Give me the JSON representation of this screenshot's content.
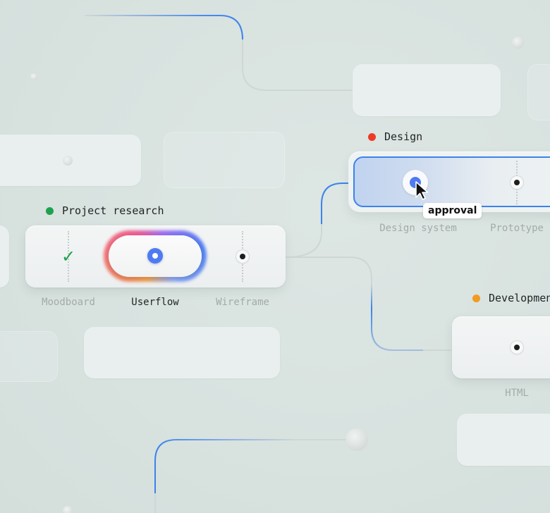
{
  "colors": {
    "background": "#d8e3e0",
    "connector_blue": "#3c83ec",
    "status_green": "#1ca24e",
    "status_red": "#ee3a26",
    "status_orange": "#f29a22",
    "check_green": "#1aa24c",
    "node_blue": "#4f7bf1"
  },
  "groups": {
    "project_research": {
      "title": "Project research",
      "status_color": "#1ca24e",
      "steps": [
        {
          "label": "Moodboard",
          "state": "done",
          "icon": "checkmark-icon"
        },
        {
          "label": "Userflow",
          "state": "active",
          "icon": "active-node-icon"
        },
        {
          "label": "Wireframe",
          "state": "pending",
          "icon": "node-icon"
        }
      ]
    },
    "design": {
      "title": "Design",
      "status_color": "#ee3a26",
      "steps": [
        {
          "label": "Design system",
          "state": "selected",
          "icon": "active-node-icon"
        },
        {
          "label": "Prototype",
          "state": "pending",
          "icon": "node-icon"
        }
      ]
    },
    "development": {
      "title": "Development",
      "status_color": "#f29a22",
      "steps": [
        {
          "label": "HTML",
          "state": "pending",
          "icon": "node-icon"
        }
      ]
    }
  },
  "tooltip": {
    "text": "approval"
  },
  "cursor": {
    "icon": "pointer-cursor-icon"
  }
}
